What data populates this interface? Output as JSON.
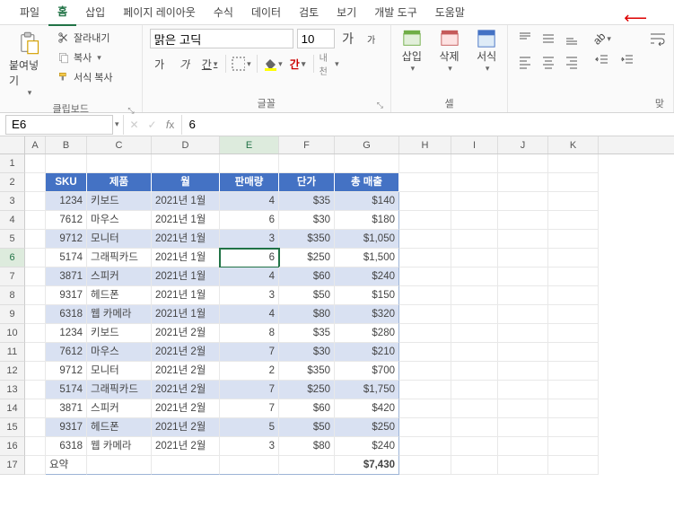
{
  "menu": [
    "파일",
    "홈",
    "삽입",
    "페이지 레이아웃",
    "수식",
    "데이터",
    "검토",
    "보기",
    "개발 도구",
    "도움말"
  ],
  "activeMenu": "홈",
  "ribbon": {
    "clipboard": {
      "label": "클립보드",
      "paste": "붙여넣기",
      "cut": "잘라내기",
      "copy": "복사",
      "format": "서식 복사"
    },
    "font": {
      "label": "글꼴",
      "name": "맑은 고딕",
      "size": "10",
      "incr": "가",
      "decr": "가"
    },
    "cells": {
      "label": "셀",
      "insert": "삽입",
      "delete": "삭제",
      "format": "서식"
    },
    "align": {
      "label": "맞"
    }
  },
  "namebox": "E6",
  "formula": "6",
  "cols": [
    "A",
    "B",
    "C",
    "D",
    "E",
    "F",
    "G",
    "H",
    "I",
    "J",
    "K"
  ],
  "rownums": [
    1,
    2,
    3,
    4,
    5,
    6,
    7,
    8,
    9,
    10,
    11,
    12,
    13,
    14,
    15,
    16,
    17
  ],
  "headers": [
    "SKU",
    "제품",
    "월",
    "판매량",
    "단가",
    "총 매출"
  ],
  "rows": [
    {
      "sku": "1234",
      "prod": "키보드",
      "mon": "2021년 1월",
      "qty": "4",
      "price": "$35",
      "tot": "$140",
      "band": true
    },
    {
      "sku": "7612",
      "prod": "마우스",
      "mon": "2021년 1월",
      "qty": "6",
      "price": "$30",
      "tot": "$180",
      "band": false
    },
    {
      "sku": "9712",
      "prod": "모니터",
      "mon": "2021년 1월",
      "qty": "3",
      "price": "$350",
      "tot": "$1,050",
      "band": true
    },
    {
      "sku": "5174",
      "prod": "그래픽카드",
      "mon": "2021년 1월",
      "qty": "6",
      "price": "$250",
      "tot": "$1,500",
      "band": false
    },
    {
      "sku": "3871",
      "prod": "스피커",
      "mon": "2021년 1월",
      "qty": "4",
      "price": "$60",
      "tot": "$240",
      "band": true
    },
    {
      "sku": "9317",
      "prod": "헤드폰",
      "mon": "2021년 1월",
      "qty": "3",
      "price": "$50",
      "tot": "$150",
      "band": false
    },
    {
      "sku": "6318",
      "prod": "웹 카메라",
      "mon": "2021년 1월",
      "qty": "4",
      "price": "$80",
      "tot": "$320",
      "band": true
    },
    {
      "sku": "1234",
      "prod": "키보드",
      "mon": "2021년 2월",
      "qty": "8",
      "price": "$35",
      "tot": "$280",
      "band": false
    },
    {
      "sku": "7612",
      "prod": "마우스",
      "mon": "2021년 2월",
      "qty": "7",
      "price": "$30",
      "tot": "$210",
      "band": true
    },
    {
      "sku": "9712",
      "prod": "모니터",
      "mon": "2021년 2월",
      "qty": "2",
      "price": "$350",
      "tot": "$700",
      "band": false
    },
    {
      "sku": "5174",
      "prod": "그래픽카드",
      "mon": "2021년 2월",
      "qty": "7",
      "price": "$250",
      "tot": "$1,750",
      "band": true
    },
    {
      "sku": "3871",
      "prod": "스피커",
      "mon": "2021년 2월",
      "qty": "7",
      "price": "$60",
      "tot": "$420",
      "band": false
    },
    {
      "sku": "9317",
      "prod": "헤드폰",
      "mon": "2021년 2월",
      "qty": "5",
      "price": "$50",
      "tot": "$250",
      "band": true
    },
    {
      "sku": "6318",
      "prod": "웹 카메라",
      "mon": "2021년 2월",
      "qty": "3",
      "price": "$80",
      "tot": "$240",
      "band": false
    }
  ],
  "summary": {
    "label": "요약",
    "total": "$7,430"
  },
  "activeCell": {
    "row": 6,
    "col": "E"
  }
}
